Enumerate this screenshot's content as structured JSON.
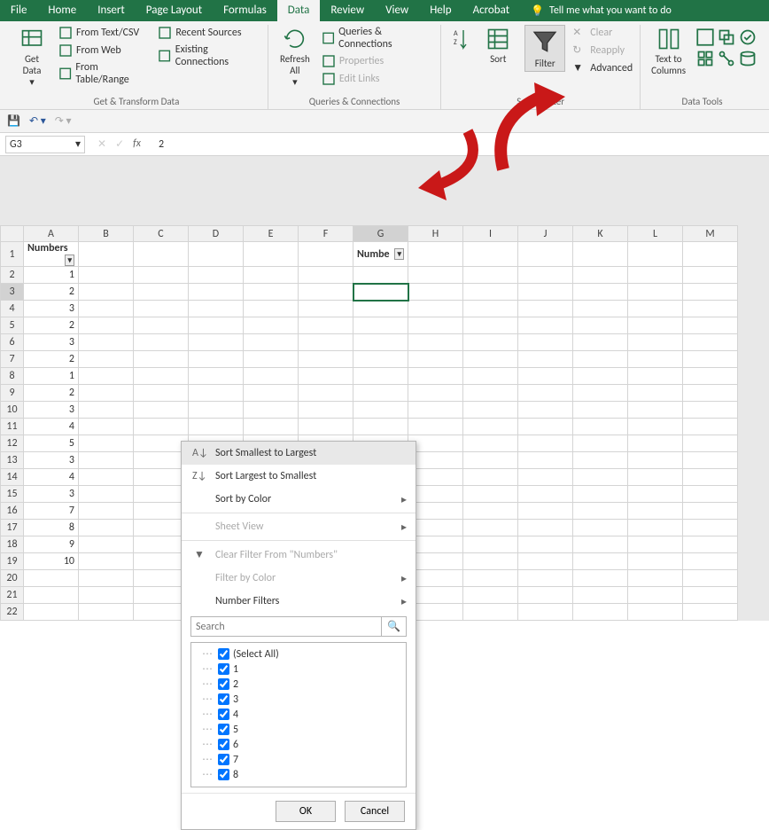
{
  "tabs": [
    "File",
    "Home",
    "Insert",
    "Page Layout",
    "Formulas",
    "Data",
    "Review",
    "View",
    "Help",
    "Acrobat"
  ],
  "active_tab": "Data",
  "tell_me": "Tell me what you want to do",
  "ribbon": {
    "get_data": {
      "label": "Get & Transform Data",
      "get": "Get\nData",
      "items": [
        "From Text/CSV",
        "From Web",
        "From Table/Range"
      ],
      "right": [
        "Recent Sources",
        "Existing Connections"
      ]
    },
    "queries": {
      "label": "Queries & Connections",
      "refresh": "Refresh\nAll",
      "items": [
        "Queries & Connections",
        "Properties",
        "Edit Links"
      ]
    },
    "sortfilter": {
      "label": "Sort & Filter",
      "sort": "Sort",
      "filter": "Filter",
      "clear": "Clear",
      "reapply": "Reapply",
      "advanced": "Advanced"
    },
    "datatools": {
      "label": "Data Tools",
      "ttc": "Text to\nColumns"
    }
  },
  "namebox": "G3",
  "formula_value": "2",
  "columns": [
    "A",
    "B",
    "C",
    "D",
    "E",
    "F",
    "G",
    "H",
    "I",
    "J",
    "K",
    "L",
    "M"
  ],
  "header_a": "Numbers",
  "header_g": "Numbe",
  "col_a_values": [
    1,
    2,
    3,
    2,
    3,
    2,
    1,
    2,
    3,
    4,
    5,
    3,
    4,
    3,
    7,
    8,
    9,
    10
  ],
  "menu": {
    "s2l": "Sort Smallest to Largest",
    "l2s": "Sort Largest to Smallest",
    "sbc": "Sort by Color",
    "sv": "Sheet View",
    "clr": "Clear Filter From \"Numbers\"",
    "fbc": "Filter by Color",
    "nf": "Number Filters",
    "search_ph": "Search",
    "select_all": "(Select All)",
    "values": [
      "1",
      "2",
      "3",
      "4",
      "5",
      "6",
      "7",
      "8"
    ],
    "ok": "OK",
    "cancel": "Cancel"
  }
}
